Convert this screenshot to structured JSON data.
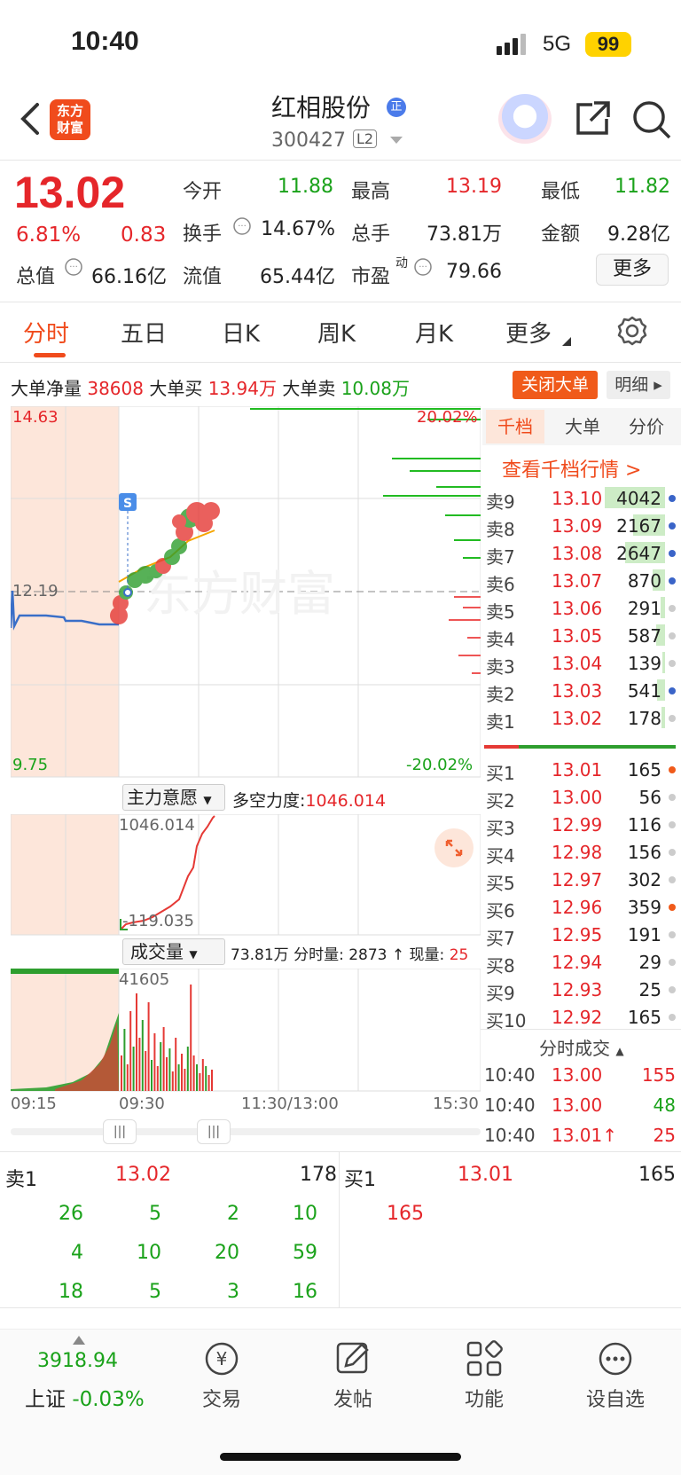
{
  "status": {
    "time": "10:40",
    "network": "5G",
    "battery": "99"
  },
  "header": {
    "name": "红相股份",
    "code": "300427",
    "level": "L2",
    "logo_line1": "东方",
    "logo_line2": "财富"
  },
  "quote": {
    "price": "13.02",
    "change_pct": "6.81%",
    "change_amt": "0.83",
    "open_label": "今开",
    "open": "11.88",
    "high_label": "最高",
    "high": "13.19",
    "low_label": "最低",
    "low": "11.82",
    "turnover_rate_label": "换手",
    "turnover_rate": "14.67%",
    "volume_label": "总手",
    "volume": "73.81万",
    "amount_label": "金额",
    "amount": "9.28亿",
    "mktcap_label": "总值",
    "mktcap": "66.16亿",
    "float_label": "流值",
    "float_cap": "65.44亿",
    "pe_label": "市盈",
    "pe_sup": "动",
    "pe": "79.66",
    "more": "更多"
  },
  "tabs": [
    "分时",
    "五日",
    "日K",
    "周K",
    "月K",
    "更多"
  ],
  "big_order": {
    "net_label": "大单净量",
    "net": "38608",
    "buy_label": "大单买",
    "buy": "13.94万",
    "sell_label": "大单卖",
    "sell": "10.08万",
    "close": "关闭大单",
    "detail": "明细"
  },
  "chart": {
    "top_price": "14.63",
    "top_pct": "20.02%",
    "mid_price": "12.19",
    "bottom_price": "9.75",
    "bottom_pct": "-20.02%",
    "time_labels": [
      "09:15",
      "09:30",
      "11:30/13:00",
      "15:30"
    ],
    "indicator_label": "主力意愿",
    "indicator_name": "多空力度:",
    "indicator_value": "1046.014",
    "ind_high": "1046.014",
    "ind_low": "-119.035",
    "vol_label": "成交量",
    "vol_total": "73.81万",
    "vol_fs_label": "分时量:",
    "vol_fs": "2873",
    "vol_now_label": "现量:",
    "vol_now": "25",
    "vol_max": "41605",
    "s_marker": "S",
    "watermark": "东方财富"
  },
  "order_book": {
    "tabs": [
      "千档",
      "大单",
      "分价"
    ],
    "link": "查看千档行情 >",
    "asks": [
      {
        "label": "卖9",
        "price": "13.10",
        "vol": "4042",
        "bar": 0.95,
        "dot": "blue"
      },
      {
        "label": "卖8",
        "price": "13.09",
        "vol": "2167",
        "bar": 0.5,
        "dot": "blue"
      },
      {
        "label": "卖7",
        "price": "13.08",
        "vol": "2647",
        "bar": 0.62,
        "dot": "blue"
      },
      {
        "label": "卖6",
        "price": "13.07",
        "vol": "870",
        "bar": 0.2,
        "dot": "blue"
      },
      {
        "label": "卖5",
        "price": "13.06",
        "vol": "291",
        "bar": 0.07,
        "dot": "gray"
      },
      {
        "label": "卖4",
        "price": "13.05",
        "vol": "587",
        "bar": 0.14,
        "dot": "gray"
      },
      {
        "label": "卖3",
        "price": "13.04",
        "vol": "139",
        "bar": 0.04,
        "dot": "gray"
      },
      {
        "label": "卖2",
        "price": "13.03",
        "vol": "541",
        "bar": 0.13,
        "dot": "blue"
      },
      {
        "label": "卖1",
        "price": "13.02",
        "vol": "178",
        "bar": 0.05,
        "dot": "gray"
      }
    ],
    "bids": [
      {
        "label": "买1",
        "price": "13.01",
        "vol": "165",
        "dot": "orange"
      },
      {
        "label": "买2",
        "price": "13.00",
        "vol": "56",
        "dot": "gray"
      },
      {
        "label": "买3",
        "price": "12.99",
        "vol": "116",
        "dot": "gray"
      },
      {
        "label": "买4",
        "price": "12.98",
        "vol": "156",
        "dot": "gray"
      },
      {
        "label": "买5",
        "price": "12.97",
        "vol": "302",
        "dot": "gray"
      },
      {
        "label": "买6",
        "price": "12.96",
        "vol": "359",
        "dot": "orange"
      },
      {
        "label": "买7",
        "price": "12.95",
        "vol": "191",
        "dot": "gray"
      },
      {
        "label": "买8",
        "price": "12.94",
        "vol": "29",
        "dot": "gray"
      },
      {
        "label": "买9",
        "price": "12.93",
        "vol": "25",
        "dot": "gray"
      },
      {
        "label": "买10",
        "price": "12.92",
        "vol": "165",
        "dot": "gray"
      }
    ],
    "ticks_title": "分时成交",
    "ticks": [
      {
        "time": "10:40",
        "price": "13.00",
        "vol": "155"
      },
      {
        "time": "10:40",
        "price": "13.00",
        "vol": "48"
      },
      {
        "time": "10:40",
        "price": "13.01↑",
        "vol": "25"
      }
    ]
  },
  "detail": {
    "sell_label": "卖1",
    "sell_price": "13.02",
    "sell_vol": "178",
    "buy_label": "买1",
    "buy_price": "13.01",
    "buy_vol": "165",
    "sell_orders": [
      [
        "26",
        "5",
        "2",
        "10"
      ],
      [
        "4",
        "10",
        "20",
        "59"
      ],
      [
        "18",
        "5",
        "3",
        "16"
      ]
    ],
    "buy_orders": [
      "165"
    ]
  },
  "bottom_nav": {
    "index_value": "3918.94",
    "index_name": "上证",
    "index_change": "-0.03%",
    "trade": "交易",
    "post": "发帖",
    "func": "功能",
    "watch": "设自选"
  }
}
